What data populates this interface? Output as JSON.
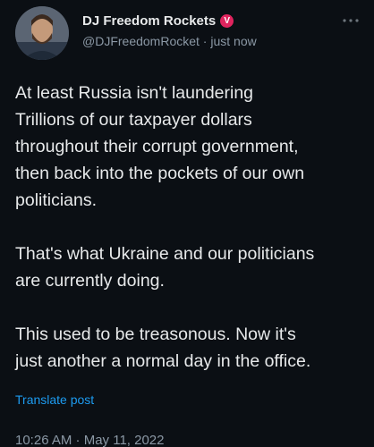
{
  "post": {
    "author": {
      "display_name": "DJ Freedom Rockets",
      "verified_badge": "V",
      "handle": "@DJFreedomRocket",
      "separator": " · ",
      "time_ago": "just now"
    },
    "more_icon": "more-horizontal-icon",
    "paragraphs": [
      "At least Russia isn't laundering\nTrillions of our taxpayer dollars\nthroughout their corrupt government,\nthen back into the pockets of our own\npoliticians.",
      "That's what Ukraine and our politicians\nare currently doing.",
      "This used to be treasonous. Now it's\njust another a normal day in the office."
    ],
    "translate_label": "Translate post",
    "timestamp": "10:26 AM · May 11, 2022"
  },
  "colors": {
    "background": "#0b0f14",
    "text": "#e7e9ea",
    "muted": "#8b98a5",
    "link": "#1d9bf0",
    "badge": "#e0245e"
  }
}
